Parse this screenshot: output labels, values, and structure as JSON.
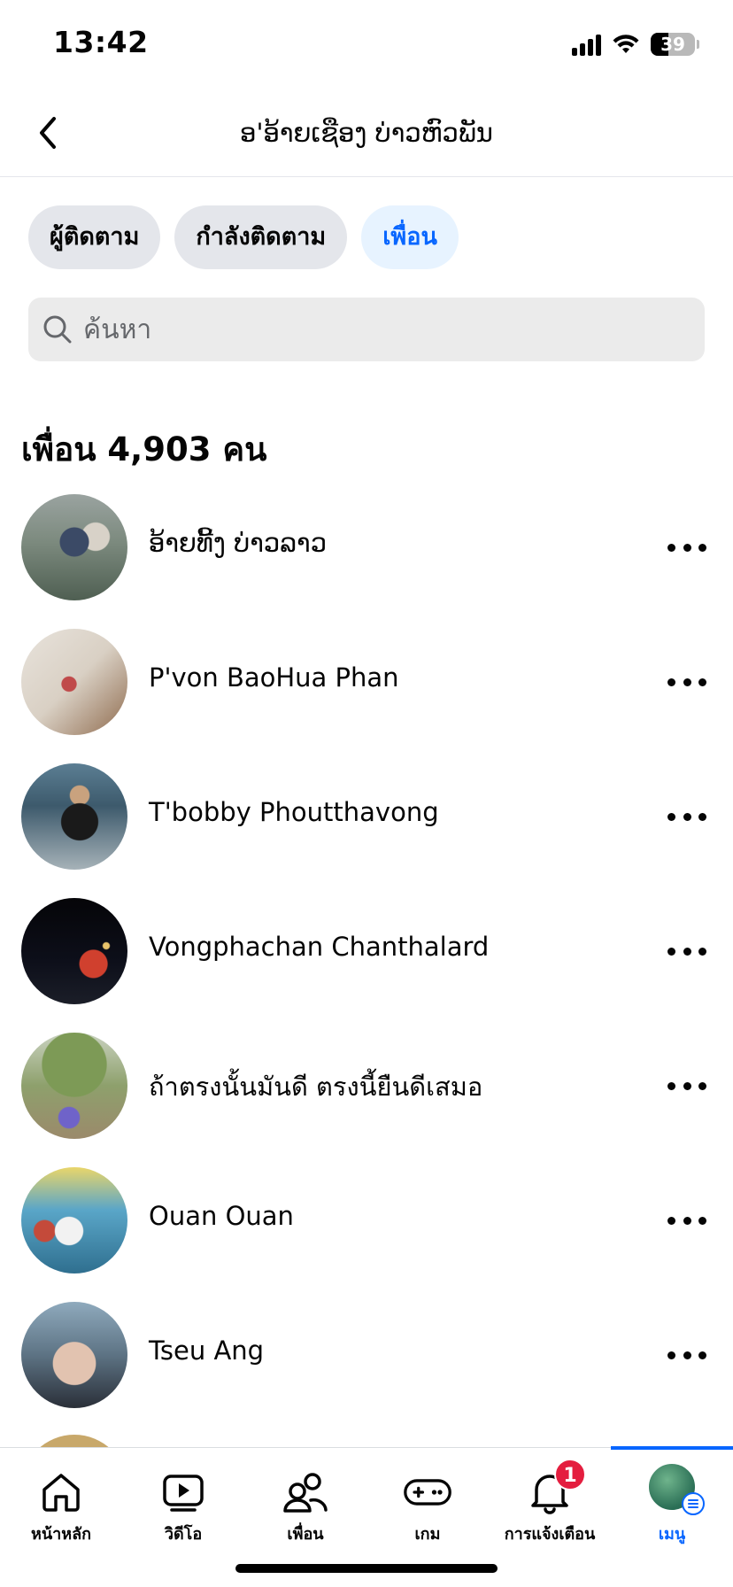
{
  "status_bar": {
    "time": "13:42",
    "battery": "39",
    "battery_level": 0.39
  },
  "header": {
    "title": "ອ'ອ້າຍເຊືອງ ບ່າວຫົວພັນ"
  },
  "chips": [
    {
      "label": "ผู้ติดตาม",
      "active": false
    },
    {
      "label": "กำลังติดตาม",
      "active": false
    },
    {
      "label": "เพื่อน",
      "active": true
    }
  ],
  "search": {
    "placeholder": "ค้นหา",
    "value": ""
  },
  "friends": {
    "heading": "เพื่อน 4,903 คน",
    "items": [
      {
        "name": "ອ້າຍທີ້ງ ບ່າວລາວ"
      },
      {
        "name": "P'von BaoHua Phan"
      },
      {
        "name": "T'bobby Phoutthavong"
      },
      {
        "name": "Vongphachan Chanthalard"
      },
      {
        "name": "ถ้าตรงนั้นมันดี ตรงนี้ยืนดีเสมอ"
      },
      {
        "name": "Ouan Ouan"
      },
      {
        "name": "Tseu Ang"
      }
    ]
  },
  "bottom_nav": {
    "items": [
      {
        "label": "หน้าหลัก",
        "icon": "home-icon"
      },
      {
        "label": "วิดีโอ",
        "icon": "video-icon"
      },
      {
        "label": "เพื่อน",
        "icon": "friends-icon"
      },
      {
        "label": "เกม",
        "icon": "gaming-icon"
      },
      {
        "label": "การแจ้งเตือน",
        "icon": "bell-icon",
        "badge": "1"
      },
      {
        "label": "เมนู",
        "icon": "menu-avatar",
        "active": true
      }
    ]
  },
  "colors": {
    "accent": "#0866ff",
    "badge": "#e41e3f",
    "chip": "#e4e6eb",
    "chip_active": "#e7f3ff"
  }
}
